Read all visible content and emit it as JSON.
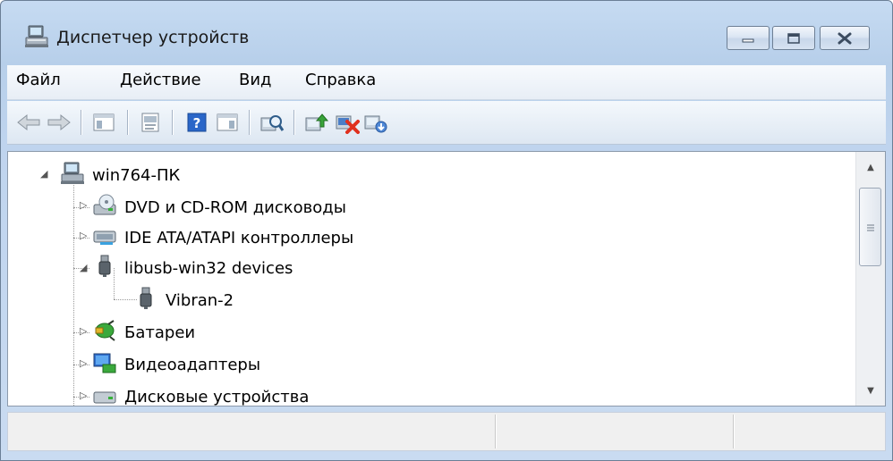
{
  "window": {
    "title": "Диспетчер устройств"
  },
  "menu": [
    "Файл",
    "Действие",
    "Вид",
    "Справка"
  ],
  "toolbar": [
    "back-icon",
    "forward-icon",
    "show-hide-console-tree-icon",
    "properties-icon",
    "help-icon",
    "action-pane-icon",
    "scan-hardware-icon",
    "update-driver-icon",
    "disable-device-icon",
    "uninstall-device-icon"
  ],
  "tree": {
    "root": "win764-ПК",
    "items": [
      {
        "label": "DVD и CD-ROM дисководы",
        "expanded": false,
        "icon": "dvd-drive-icon"
      },
      {
        "label": "IDE ATA/ATAPI контроллеры",
        "expanded": false,
        "icon": "ide-controller-icon"
      },
      {
        "label": "libusb-win32 devices",
        "expanded": true,
        "icon": "usb-device-icon",
        "children": [
          "Vibran-2"
        ]
      },
      {
        "label": "Батареи",
        "expanded": false,
        "icon": "battery-icon"
      },
      {
        "label": "Видеоадаптеры",
        "expanded": false,
        "icon": "display-adapter-icon"
      },
      {
        "label": "Дисковые устройства",
        "expanded": false,
        "icon": "disk-drive-icon"
      }
    ]
  },
  "colors": {
    "chrome": "#c6dbf2",
    "accent": "#2a66c8",
    "close_red": "#e0301e"
  }
}
